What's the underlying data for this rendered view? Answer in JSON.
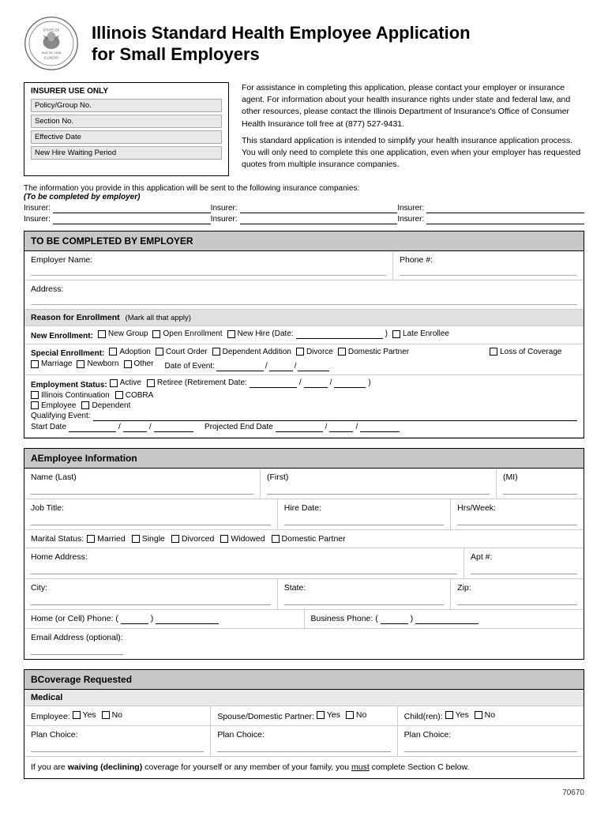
{
  "header": {
    "title_line1": "Illinois Standard Health Employee Application",
    "title_line2": "for Small Employers"
  },
  "insurer_use_only": {
    "title": "INSURER USE ONLY",
    "fields": [
      "Policy/Group No.",
      "Section No.",
      "Effective Date",
      "New Hire Waiting Period"
    ]
  },
  "info_paragraphs": {
    "p1": "For assistance in completing this application, please contact your employer or insurance agent. For information about your health insurance rights under state and federal law, and other resources, please contact the Illinois Department of Insurance's Office of Consumer Health Insurance toll free at (877) 527-9431.",
    "p2": "This standard application is intended to simplify your health insurance application process. You will only need to complete this one application, even when your employer has requested quotes from multiple insurance companies."
  },
  "insurer_lines": {
    "intro": "The information you provide in this application will be sent to the following insurance companies:",
    "note": "(To be completed by employer)",
    "label1": "Insurer:",
    "label2": "Insurer:",
    "label3": "Insurer:",
    "label4": "Insurer:",
    "label5": "Insurer:",
    "label6": "Insurer:"
  },
  "employer_section": {
    "header": "TO BE COMPLETED BY EMPLOYER",
    "employer_name_label": "Employer Name:",
    "phone_label": "Phone #:",
    "address_label": "Address:",
    "reason_header": "Reason for Enrollment",
    "reason_note": "(Mark all that apply)",
    "new_enrollment_label": "New Enrollment:",
    "new_enrollment_options": [
      "New Group",
      "Open Enrollment",
      "New Hire (Date:",
      "Late Enrollee"
    ],
    "special_enrollment_label": "Special Enrollment:",
    "special_enrollment_options": [
      "Adoption",
      "Court Order",
      "Dependent Addition",
      "Divorce",
      "Domestic Partner",
      "Loss of Coverage",
      "Marriage",
      "Newborn",
      "Other"
    ],
    "date_of_event_label": "Date of Event:",
    "employment_status_label": "Employment Status:",
    "status_options1": [
      "Active",
      "Retiree (Retirement Date:"
    ],
    "status_options2": [
      "Illinois Continuation",
      "COBRA"
    ],
    "status_options3": [
      "Employee",
      "Dependent"
    ],
    "qualifying_event_label": "Qualifying Event:",
    "start_date_label": "Start Date",
    "projected_end_label": "Projected End Date"
  },
  "employee_section": {
    "header": "Employee Information",
    "letter": "A",
    "name_last_label": "Name (Last)",
    "name_first_label": "(First)",
    "name_mi_label": "(MI)",
    "job_title_label": "Job Title:",
    "hire_date_label": "Hire Date:",
    "hrs_week_label": "Hrs/Week:",
    "marital_label": "Marital Status:",
    "marital_options": [
      "Married",
      "Single",
      "Divorced",
      "Widowed",
      "Domestic Partner"
    ],
    "home_address_label": "Home Address:",
    "apt_label": "Apt #:",
    "city_label": "City:",
    "state_label": "State:",
    "zip_label": "Zip:",
    "home_phone_label": "Home (or Cell) Phone: (",
    "home_phone_close": ")",
    "business_phone_label": "Business Phone: (",
    "business_phone_close": ")",
    "email_label": "Email Address (optional):"
  },
  "coverage_section": {
    "header": "Coverage Requested",
    "letter": "B",
    "medical_label": "Medical",
    "employee_label": "Employee:",
    "yes": "Yes",
    "no": "No",
    "spouse_label": "Spouse/Domestic Partner:",
    "children_label": "Child(ren):",
    "plan_choice_label": "Plan Choice:",
    "waiving_text_1": "If you are ",
    "waiving_bold": "waiving (declining)",
    "waiving_text_2": " coverage for yourself or any member of your family, you ",
    "waiving_underline": "must",
    "waiving_text_3": " complete Section C below."
  },
  "footer": {
    "form_number": "70670"
  }
}
